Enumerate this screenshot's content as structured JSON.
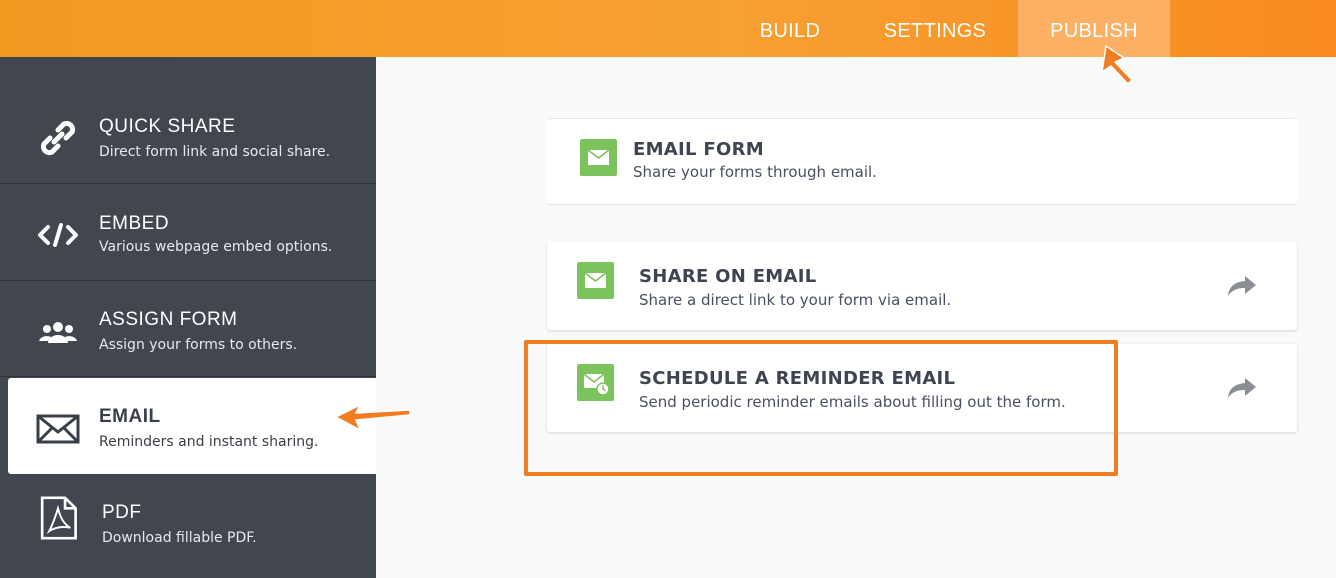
{
  "topbar": {
    "tabs": [
      {
        "label": "BUILD"
      },
      {
        "label": "SETTINGS"
      },
      {
        "label": "PUBLISH"
      }
    ],
    "active_tab": "PUBLISH"
  },
  "sidebar": {
    "items": [
      {
        "title": "QUICK SHARE",
        "desc": "Direct form link and social share.",
        "icon": "link-icon"
      },
      {
        "title": "EMBED",
        "desc": "Various webpage embed options.",
        "icon": "code-icon"
      },
      {
        "title": "ASSIGN FORM",
        "desc": "Assign your forms to others.",
        "icon": "users-icon"
      },
      {
        "title": "EMAIL",
        "desc": "Reminders and instant sharing.",
        "icon": "envelope-icon"
      },
      {
        "title": "PDF",
        "desc": "Download fillable PDF.",
        "icon": "pdf-icon"
      }
    ],
    "active_item": "EMAIL"
  },
  "main": {
    "email_form": {
      "title": "EMAIL FORM",
      "desc": "Share your forms through email."
    },
    "share_on_email": {
      "title": "SHARE ON EMAIL",
      "desc": "Share a direct link to your form via email."
    },
    "schedule_reminder": {
      "title": "SCHEDULE A REMINDER EMAIL",
      "desc": "Send periodic reminder emails about filling out the form."
    }
  },
  "colors": {
    "accent_orange": "#f47c20",
    "sidebar_bg": "#41464f",
    "icon_green": "#7cc35e"
  }
}
